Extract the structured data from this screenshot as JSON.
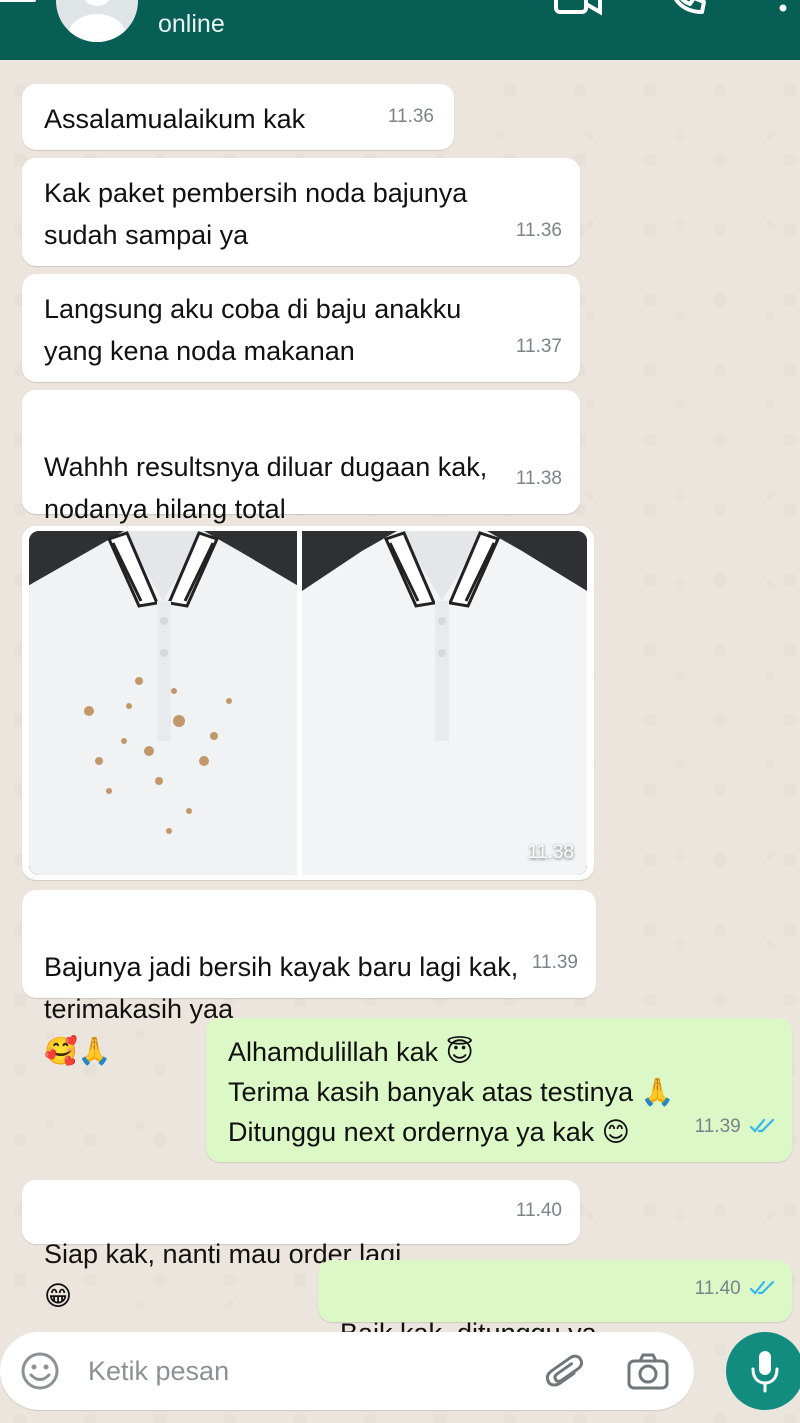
{
  "header": {
    "status": "online",
    "colors": {
      "bar": "#075e54"
    }
  },
  "messages": [
    {
      "dir": "in",
      "text": "Assalamualaikum kak",
      "time": "11.36"
    },
    {
      "dir": "in",
      "text": "Kak paket pembersih noda bajunya\nsudah sampai ya",
      "time": "11.36"
    },
    {
      "dir": "in",
      "text": "Langsung aku coba di baju anakku\nyang kena noda makanan",
      "time": "11.37"
    },
    {
      "dir": "in",
      "text": "Wahhh resultsnya diluar dugaan kak,\nnodanya hilang total",
      "emoji": "😍😍",
      "time": "11.38"
    },
    {
      "dir": "in",
      "type": "image",
      "time": "11.38"
    },
    {
      "dir": "in",
      "text": "Bajunya jadi bersih kayak baru lagi kak,\nterimakasih yaa",
      "emoji": "🥰🙏",
      "time": "11.39"
    },
    {
      "dir": "out",
      "lines": [
        {
          "text": "Alhamdulillah kak",
          "emoji": "😇"
        },
        {
          "text": "Terima kasih banyak atas testinya",
          "emoji": "🙏"
        },
        {
          "text": "Ditunggu next ordernya ya kak",
          "emoji": "😊"
        }
      ],
      "time": "11.39",
      "read": true
    },
    {
      "dir": "in",
      "text": "Siap kak, nanti mau order lagi",
      "emoji": "😁",
      "time": "11.40"
    },
    {
      "dir": "out",
      "text": "Baik kak, ditunggu ya",
      "emoji": "😊",
      "time": "11.40",
      "read": true
    }
  ],
  "input": {
    "placeholder": "Ketik pesan",
    "icons": [
      "emoji-icon",
      "attach-icon",
      "camera-icon",
      "mic-icon"
    ]
  },
  "colors": {
    "incoming": "#ffffff",
    "outgoing": "#dcf8c6",
    "read_ticks": "#34b7f1",
    "accent": "#128c7e"
  }
}
